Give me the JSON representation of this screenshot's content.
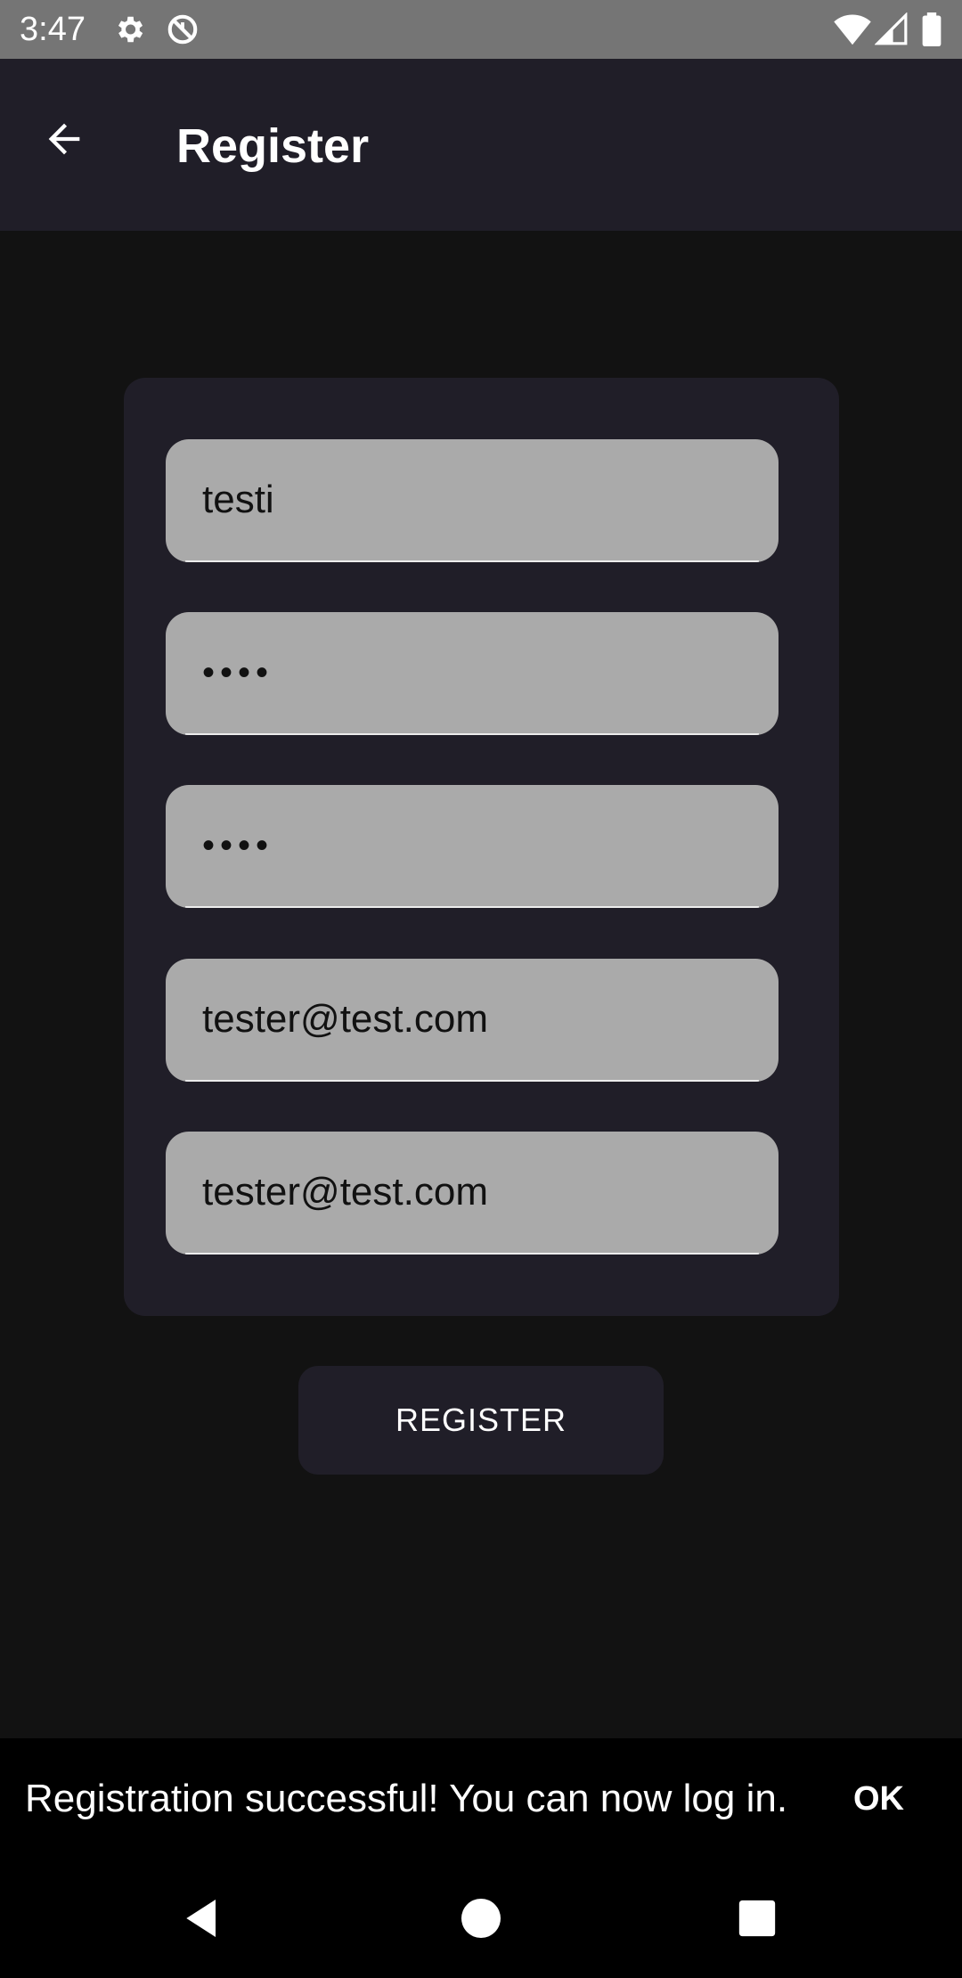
{
  "status_bar": {
    "time": "3:47",
    "icons": [
      "gear-icon",
      "no-sync-icon",
      "wifi-icon",
      "signal-icon",
      "battery-icon"
    ]
  },
  "app_bar": {
    "title": "Register",
    "back_icon": "arrow-back-icon"
  },
  "form": {
    "fields": [
      {
        "name": "username",
        "value": "testi"
      },
      {
        "name": "password",
        "value": "••••"
      },
      {
        "name": "password-confirm",
        "value": "••••"
      },
      {
        "name": "email",
        "value": "tester@test.com"
      },
      {
        "name": "email-confirm",
        "value": "tester@test.com"
      }
    ]
  },
  "register_button": {
    "label": "REGISTER"
  },
  "snackbar": {
    "message": "Registration successful! You can now log in.",
    "action": "OK"
  },
  "nav_bar": {
    "icons": [
      "nav-back-icon",
      "nav-home-icon",
      "nav-recents-icon"
    ]
  },
  "colors": {
    "background": "#121212",
    "status_bar": "#757575",
    "surface": "#201e28",
    "field": "#aaaaaa",
    "snackbar": "#000000"
  }
}
